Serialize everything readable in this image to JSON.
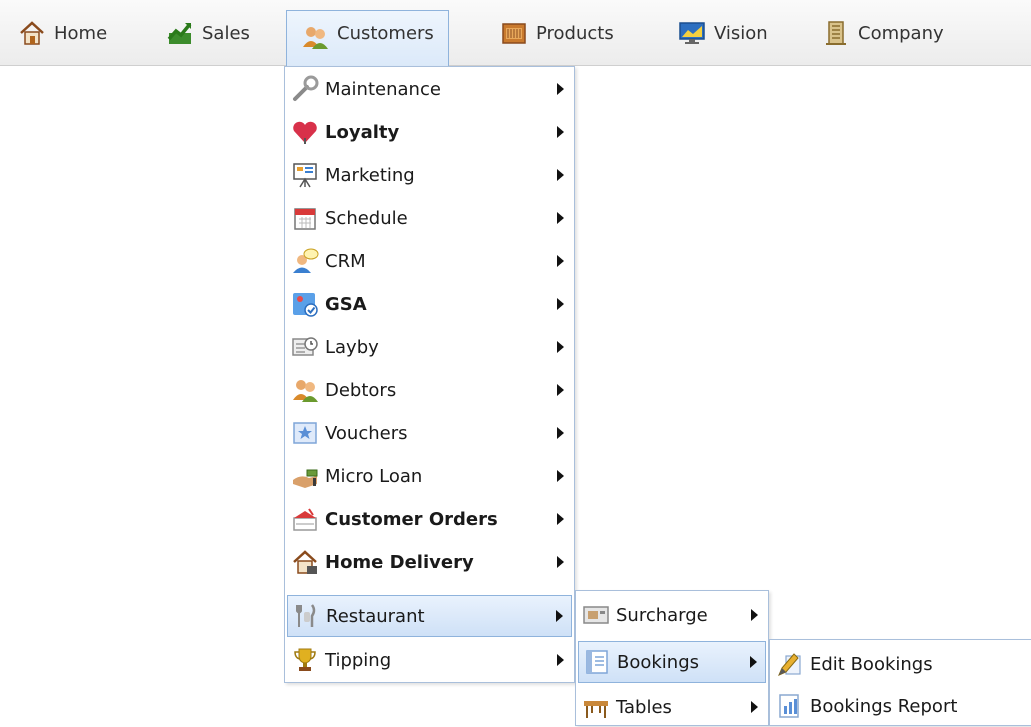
{
  "topnav": {
    "items": [
      {
        "label": "Home",
        "icon": "house-icon"
      },
      {
        "label": "Sales",
        "icon": "sales-chart-icon"
      },
      {
        "label": "Customers",
        "icon": "people-icon"
      },
      {
        "label": "Products",
        "icon": "box-icon"
      },
      {
        "label": "Vision",
        "icon": "monitor-icon"
      },
      {
        "label": "Company",
        "icon": "building-icon"
      }
    ],
    "active": "Customers"
  },
  "customers_menu": {
    "items": [
      {
        "label": "Maintenance",
        "bold": false,
        "icon": "wrench-icon"
      },
      {
        "label": "Loyalty",
        "bold": true,
        "icon": "heart-icon"
      },
      {
        "label": "Marketing",
        "bold": false,
        "icon": "presentation-board-icon"
      },
      {
        "label": "Schedule",
        "bold": false,
        "icon": "calendar-icon"
      },
      {
        "label": "CRM",
        "bold": false,
        "icon": "person-chat-icon"
      },
      {
        "label": "GSA",
        "bold": true,
        "icon": "gsa-check-icon"
      },
      {
        "label": "Layby",
        "bold": false,
        "icon": "layby-clock-icon"
      },
      {
        "label": "Debtors",
        "bold": false,
        "icon": "people-icon"
      },
      {
        "label": "Vouchers",
        "bold": false,
        "icon": "voucher-icon"
      },
      {
        "label": "Micro Loan",
        "bold": false,
        "icon": "cash-hand-icon"
      },
      {
        "label": "Customer Orders",
        "bold": true,
        "icon": "order-basket-icon"
      },
      {
        "label": "Home Delivery",
        "bold": true,
        "icon": "home-delivery-icon"
      },
      {
        "label": "Restaurant",
        "bold": false,
        "icon": "cutlery-icon"
      },
      {
        "label": "Tipping",
        "bold": false,
        "icon": "trophy-icon"
      }
    ],
    "highlighted": "Restaurant"
  },
  "restaurant_menu": {
    "items": [
      {
        "label": "Surcharge",
        "icon": "surcharge-icon"
      },
      {
        "label": "Bookings",
        "icon": "book-icon"
      },
      {
        "label": "Tables",
        "icon": "table-icon"
      }
    ],
    "highlighted": "Bookings"
  },
  "bookings_menu": {
    "items": [
      {
        "label": "Edit Bookings",
        "icon": "edit-pencil-icon"
      },
      {
        "label": "Bookings Report",
        "icon": "report-icon"
      }
    ]
  },
  "colors": {
    "highlight_border": "#8fb3dc",
    "highlight_fill": "#dbe9f9",
    "menubar_bg": "#ececec"
  }
}
